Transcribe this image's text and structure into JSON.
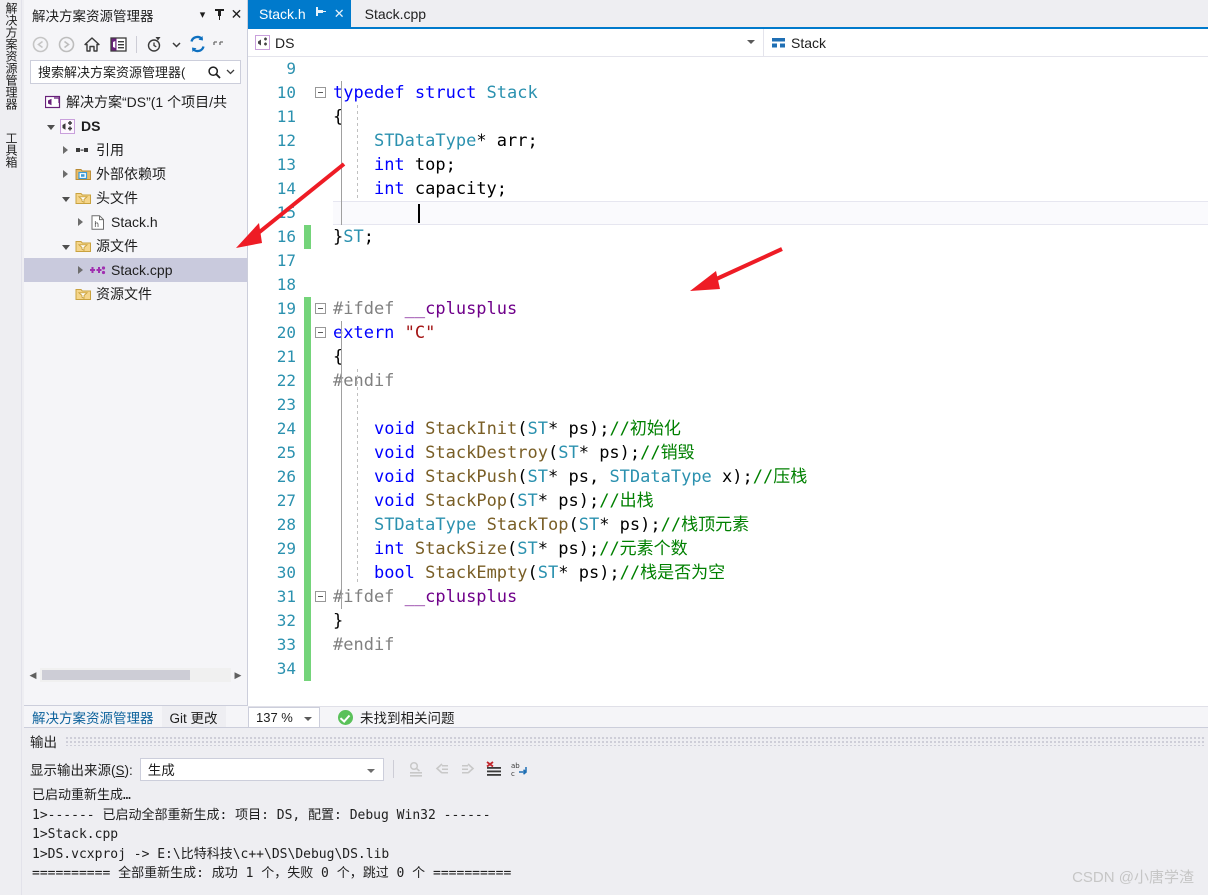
{
  "vertical_tabs": [
    {
      "label": "解决方案资源管理器",
      "name": "solution-explorer"
    },
    {
      "label": "工具箱",
      "name": "toolbox"
    }
  ],
  "solution_explorer": {
    "title": "解决方案资源管理器",
    "header_buttons": [
      {
        "name": "dropdown",
        "glyph": "▾"
      },
      {
        "name": "pin",
        "glyph": "⚲"
      },
      {
        "name": "close",
        "glyph": "✕"
      }
    ],
    "toolbar": [
      {
        "name": "back",
        "icon": "back-arrow-icon"
      },
      {
        "name": "forward",
        "icon": "forward-arrow-icon"
      },
      {
        "name": "home",
        "icon": "home-icon"
      },
      {
        "name": "show-all-files",
        "icon": "show-all-files-icon"
      },
      {
        "name": "pending-changes",
        "icon": "clock-filter-icon"
      },
      {
        "name": "refresh",
        "icon": "refresh-icon"
      },
      {
        "name": "overflow",
        "icon": "overflow-icon"
      }
    ],
    "search": {
      "placeholder": "搜索解决方案资源管理器(",
      "value": "",
      "icon": "search-icon"
    },
    "tree": [
      {
        "depth": 0,
        "twisty": "none",
        "icon": "solution-icon",
        "label": "解决方案“DS”(1 个项目/共",
        "bold": false,
        "selected": false
      },
      {
        "depth": 1,
        "twisty": "expanded",
        "icon": "project-icon",
        "label": "DS",
        "bold": true,
        "selected": false
      },
      {
        "depth": 2,
        "twisty": "collapsed",
        "icon": "references-icon",
        "label": "引用",
        "bold": false,
        "selected": false
      },
      {
        "depth": 2,
        "twisty": "collapsed",
        "icon": "ext-dep-icon",
        "label": "外部依赖项",
        "bold": false,
        "selected": false
      },
      {
        "depth": 2,
        "twisty": "expanded",
        "icon": "filter-folder-icon",
        "label": "头文件",
        "bold": false,
        "selected": false
      },
      {
        "depth": 3,
        "twisty": "collapsed",
        "icon": "h-file-icon",
        "label": "Stack.h",
        "bold": false,
        "selected": false
      },
      {
        "depth": 2,
        "twisty": "expanded",
        "icon": "filter-folder-icon",
        "label": "源文件",
        "bold": false,
        "selected": false
      },
      {
        "depth": 3,
        "twisty": "collapsed",
        "icon": "cpp-file-icon",
        "label": "Stack.cpp",
        "bold": false,
        "selected": true
      },
      {
        "depth": 2,
        "twisty": "none",
        "icon": "filter-folder-icon",
        "label": "资源文件",
        "bold": false,
        "selected": false
      }
    ],
    "hscroll": {
      "left_arrow": "◀",
      "right_arrow": "▶"
    }
  },
  "dock_tabs": [
    {
      "label": "解决方案资源管理器",
      "name": "dock-tab-solution-explorer",
      "active": true
    },
    {
      "label": "Git 更改",
      "name": "dock-tab-git-changes",
      "active": false
    }
  ],
  "editor": {
    "tabs": [
      {
        "label": "Stack.h",
        "active": true,
        "pin": "⚲",
        "close": "✕"
      },
      {
        "label": "Stack.cpp",
        "active": false
      }
    ],
    "navbar": {
      "left": {
        "value": "DS",
        "icon": "project-icon"
      },
      "right": {
        "value": "Stack",
        "icon": "struct-icon"
      }
    },
    "lines": [
      {
        "num": 9,
        "fold": "none",
        "change": false,
        "tokens": []
      },
      {
        "num": 10,
        "fold": "expanded",
        "change": false,
        "tokens": [
          {
            "t": "typedef ",
            "c": "kw"
          },
          {
            "t": "struct ",
            "c": "kw"
          },
          {
            "t": "Stack",
            "c": "typ"
          }
        ]
      },
      {
        "num": 11,
        "fold": "none",
        "change": false,
        "tokens": [
          {
            "t": "{",
            "c": "pun"
          }
        ]
      },
      {
        "num": 12,
        "fold": "none",
        "change": false,
        "tokens": [
          {
            "t": "    ",
            "c": "pun"
          },
          {
            "t": "STDataType",
            "c": "typ"
          },
          {
            "t": "* arr;",
            "c": "pun"
          }
        ]
      },
      {
        "num": 13,
        "fold": "none",
        "change": false,
        "tokens": [
          {
            "t": "    ",
            "c": "pun"
          },
          {
            "t": "int",
            "c": "kw"
          },
          {
            "t": " top;",
            "c": "pun"
          }
        ]
      },
      {
        "num": 14,
        "fold": "none",
        "change": false,
        "tokens": [
          {
            "t": "    ",
            "c": "pun"
          },
          {
            "t": "int",
            "c": "kw"
          },
          {
            "t": " capacity;",
            "c": "pun"
          }
        ]
      },
      {
        "num": 15,
        "fold": "none",
        "change": false,
        "highlight": true,
        "caret": true,
        "tokens": []
      },
      {
        "num": 16,
        "fold": "none",
        "change": true,
        "tokens": [
          {
            "t": "}",
            "c": "pun"
          },
          {
            "t": "ST",
            "c": "typ"
          },
          {
            "t": ";",
            "c": "pun"
          }
        ]
      },
      {
        "num": 17,
        "fold": "none",
        "change": false,
        "tokens": []
      },
      {
        "num": 18,
        "fold": "none",
        "change": false,
        "tokens": []
      },
      {
        "num": 19,
        "fold": "expanded",
        "change": true,
        "tokens": [
          {
            "t": "#ifdef ",
            "c": "pp"
          },
          {
            "t": "__cplusplus",
            "c": "mac"
          }
        ]
      },
      {
        "num": 20,
        "fold": "expanded",
        "change": true,
        "tokens": [
          {
            "t": "extern ",
            "c": "kw"
          },
          {
            "t": "\"C\"",
            "c": "str"
          }
        ]
      },
      {
        "num": 21,
        "fold": "none",
        "change": true,
        "tokens": [
          {
            "t": "{",
            "c": "pun"
          }
        ]
      },
      {
        "num": 22,
        "fold": "none",
        "change": true,
        "tokens": [
          {
            "t": "#endif",
            "c": "pp"
          }
        ]
      },
      {
        "num": 23,
        "fold": "none",
        "change": true,
        "tokens": []
      },
      {
        "num": 24,
        "fold": "none",
        "change": true,
        "tokens": [
          {
            "t": "    ",
            "c": "pun"
          },
          {
            "t": "void",
            "c": "kw"
          },
          {
            "t": " ",
            "c": "pun"
          },
          {
            "t": "StackInit",
            "c": "fn"
          },
          {
            "t": "(",
            "c": "pun"
          },
          {
            "t": "ST",
            "c": "typ"
          },
          {
            "t": "* ps);",
            "c": "pun"
          },
          {
            "t": "//初始化",
            "c": "cmt"
          }
        ]
      },
      {
        "num": 25,
        "fold": "none",
        "change": true,
        "tokens": [
          {
            "t": "    ",
            "c": "pun"
          },
          {
            "t": "void",
            "c": "kw"
          },
          {
            "t": " ",
            "c": "pun"
          },
          {
            "t": "StackDestroy",
            "c": "fn"
          },
          {
            "t": "(",
            "c": "pun"
          },
          {
            "t": "ST",
            "c": "typ"
          },
          {
            "t": "* ps);",
            "c": "pun"
          },
          {
            "t": "//销毁",
            "c": "cmt"
          }
        ]
      },
      {
        "num": 26,
        "fold": "none",
        "change": true,
        "tokens": [
          {
            "t": "    ",
            "c": "pun"
          },
          {
            "t": "void",
            "c": "kw"
          },
          {
            "t": " ",
            "c": "pun"
          },
          {
            "t": "StackPush",
            "c": "fn"
          },
          {
            "t": "(",
            "c": "pun"
          },
          {
            "t": "ST",
            "c": "typ"
          },
          {
            "t": "* ps, ",
            "c": "pun"
          },
          {
            "t": "STDataType",
            "c": "typ"
          },
          {
            "t": " x);",
            "c": "pun"
          },
          {
            "t": "//压栈",
            "c": "cmt"
          }
        ]
      },
      {
        "num": 27,
        "fold": "none",
        "change": true,
        "tokens": [
          {
            "t": "    ",
            "c": "pun"
          },
          {
            "t": "void",
            "c": "kw"
          },
          {
            "t": " ",
            "c": "pun"
          },
          {
            "t": "StackPop",
            "c": "fn"
          },
          {
            "t": "(",
            "c": "pun"
          },
          {
            "t": "ST",
            "c": "typ"
          },
          {
            "t": "* ps);",
            "c": "pun"
          },
          {
            "t": "//出栈",
            "c": "cmt"
          }
        ]
      },
      {
        "num": 28,
        "fold": "none",
        "change": true,
        "tokens": [
          {
            "t": "    ",
            "c": "pun"
          },
          {
            "t": "STDataType",
            "c": "typ"
          },
          {
            "t": " ",
            "c": "pun"
          },
          {
            "t": "StackTop",
            "c": "fn"
          },
          {
            "t": "(",
            "c": "pun"
          },
          {
            "t": "ST",
            "c": "typ"
          },
          {
            "t": "* ps);",
            "c": "pun"
          },
          {
            "t": "//栈顶元素",
            "c": "cmt"
          }
        ]
      },
      {
        "num": 29,
        "fold": "none",
        "change": true,
        "tokens": [
          {
            "t": "    ",
            "c": "pun"
          },
          {
            "t": "int",
            "c": "kw"
          },
          {
            "t": " ",
            "c": "pun"
          },
          {
            "t": "StackSize",
            "c": "fn"
          },
          {
            "t": "(",
            "c": "pun"
          },
          {
            "t": "ST",
            "c": "typ"
          },
          {
            "t": "* ps);",
            "c": "pun"
          },
          {
            "t": "//元素个数",
            "c": "cmt"
          }
        ]
      },
      {
        "num": 30,
        "fold": "none",
        "change": true,
        "tokens": [
          {
            "t": "    ",
            "c": "pun"
          },
          {
            "t": "bool",
            "c": "kw"
          },
          {
            "t": " ",
            "c": "pun"
          },
          {
            "t": "StackEmpty",
            "c": "fn"
          },
          {
            "t": "(",
            "c": "pun"
          },
          {
            "t": "ST",
            "c": "typ"
          },
          {
            "t": "* ps);",
            "c": "pun"
          },
          {
            "t": "//栈是否为空",
            "c": "cmt"
          }
        ]
      },
      {
        "num": 31,
        "fold": "expanded",
        "change": true,
        "tokens": [
          {
            "t": "#ifdef ",
            "c": "pp"
          },
          {
            "t": "__cplusplus",
            "c": "mac"
          }
        ]
      },
      {
        "num": 32,
        "fold": "none",
        "change": true,
        "tokens": [
          {
            "t": "}",
            "c": "pun"
          }
        ]
      },
      {
        "num": 33,
        "fold": "none",
        "change": true,
        "tokens": [
          {
            "t": "#endif",
            "c": "pp"
          }
        ]
      },
      {
        "num": 34,
        "fold": "none",
        "change": true,
        "tokens": []
      }
    ],
    "status": {
      "zoom": "137 %",
      "problems": "未找到相关问题",
      "problems_icon": "ok-check-icon"
    }
  },
  "output": {
    "title": "输出",
    "source_label_prefix": "显示输出来源(",
    "source_label_key": "S",
    "source_label_suffix": "):",
    "source_value": "生成",
    "toolbar_icons": [
      {
        "name": "find-message-icon"
      },
      {
        "name": "go-to-previous-icon"
      },
      {
        "name": "go-to-next-icon"
      },
      {
        "name": "clear-all-icon"
      },
      {
        "name": "toggle-word-wrap-icon"
      }
    ],
    "lines": [
      "已启动重新生成…",
      "1>------ 已启动全部重新生成: 项目: DS, 配置: Debug Win32 ------",
      "1>Stack.cpp",
      "1>DS.vcxproj -> E:\\比特科技\\c++\\DS\\Debug\\DS.lib",
      "========== 全部重新生成: 成功 1 个，失败 0 个，跳过 0 个 =========="
    ]
  },
  "watermark": "CSDN @小唐学渣",
  "colors": {
    "accent": "#007acc",
    "selection": "#c9cadd",
    "change_bar_green": "#74d47a",
    "annotation_red": "#ee1c25",
    "keyword_blue": "#0000ff",
    "type_teal": "#2b91af",
    "comment_green": "#008000",
    "string_red": "#a31515",
    "macro_purple": "#6f008a"
  }
}
